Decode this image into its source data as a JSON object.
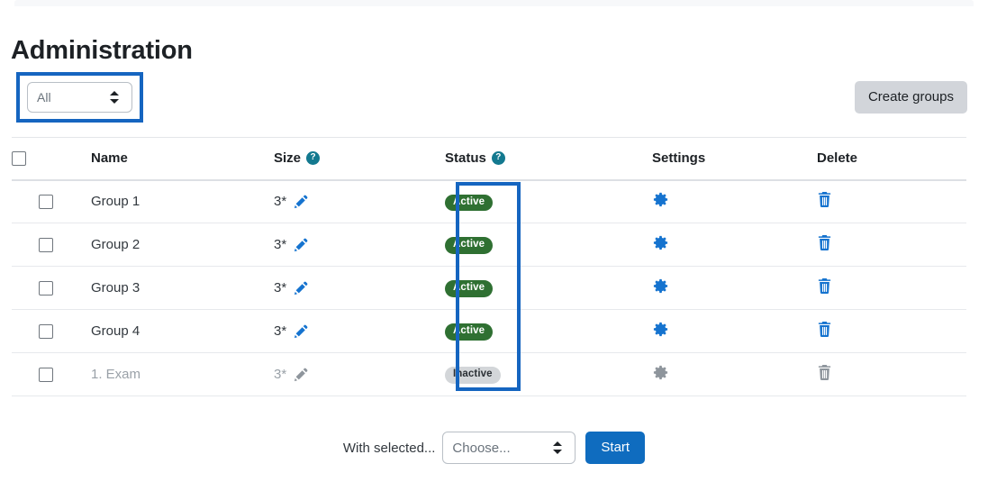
{
  "page": {
    "title": "Administration"
  },
  "filter": {
    "select_value": "All",
    "select_name": "group-filter-select",
    "create_groups_label": "Create groups"
  },
  "table": {
    "columns": [
      {
        "key": "checkbox",
        "label": ""
      },
      {
        "key": "name",
        "label": "Name"
      },
      {
        "key": "size",
        "label": "Size",
        "help": "?"
      },
      {
        "key": "status",
        "label": "Status",
        "help": "?"
      },
      {
        "key": "settings",
        "label": "Settings"
      },
      {
        "key": "delete",
        "label": "Delete"
      }
    ],
    "rows": [
      {
        "name": "Group 1",
        "size": "3*",
        "status": "Active",
        "status_kind": "active",
        "muted": false
      },
      {
        "name": "Group 2",
        "size": "3*",
        "status": "Active",
        "status_kind": "active",
        "muted": false
      },
      {
        "name": "Group 3",
        "size": "3*",
        "status": "Active",
        "status_kind": "active",
        "muted": false
      },
      {
        "name": "Group 4",
        "size": "3*",
        "status": "Active",
        "status_kind": "active",
        "muted": false
      },
      {
        "name": "1. Exam",
        "size": "3*",
        "status": "Inactive",
        "status_kind": "inactive",
        "muted": true
      }
    ]
  },
  "footer": {
    "with_selected_label": "With selected...",
    "choose_value": "Choose...",
    "start_label": "Start"
  },
  "colors": {
    "annotation_blue": "#1565c0",
    "primary_blue": "#0f6cbf",
    "badge_active_green": "#2f7032",
    "badge_inactive_gray": "#d3d6d9",
    "help_icon_teal": "#13798f",
    "create_groups_gray": "#d2d5da"
  },
  "icons": {
    "select_arrows": "updown-arrows-icon",
    "help": "help-circle-icon",
    "edit": "pencil-icon",
    "settings": "gear-icon",
    "delete": "trash-icon",
    "checkbox": "checkbox-icon"
  }
}
